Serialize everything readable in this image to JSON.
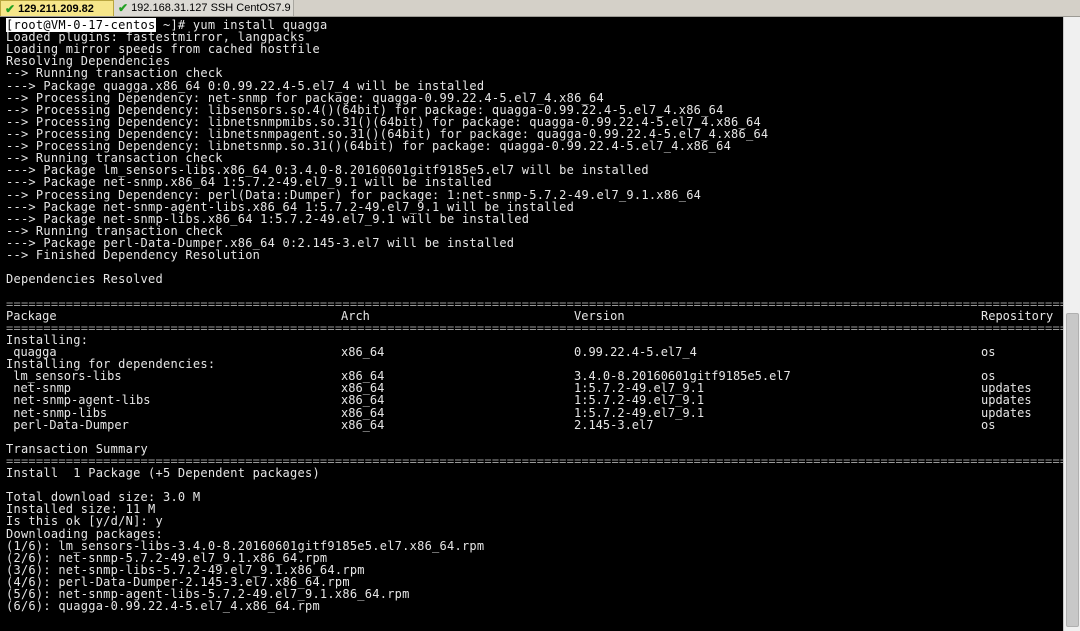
{
  "tabs": [
    {
      "label": "129.211.209.82",
      "active": true
    },
    {
      "label": "192.168.31.127 SSH CentOS7.9",
      "active": false
    }
  ],
  "prompt": {
    "user": "[root@VM-0-17-centos",
    "rest": " ~]# yum install quagga"
  },
  "pre_lines": [
    "Loaded plugins: fastestmirror, langpacks",
    "Loading mirror speeds from cached hostfile",
    "Resolving Dependencies",
    "--> Running transaction check",
    "---> Package quagga.x86_64 0:0.99.22.4-5.el7_4 will be installed",
    "--> Processing Dependency: net-snmp for package: quagga-0.99.22.4-5.el7_4.x86_64",
    "--> Processing Dependency: libsensors.so.4()(64bit) for package: quagga-0.99.22.4-5.el7_4.x86_64",
    "--> Processing Dependency: libnetsnmpmibs.so.31()(64bit) for package: quagga-0.99.22.4-5.el7_4.x86_64",
    "--> Processing Dependency: libnetsnmpagent.so.31()(64bit) for package: quagga-0.99.22.4-5.el7_4.x86_64",
    "--> Processing Dependency: libnetsnmp.so.31()(64bit) for package: quagga-0.99.22.4-5.el7_4.x86_64",
    "--> Running transaction check",
    "---> Package lm_sensors-libs.x86_64 0:3.4.0-8.20160601gitf9185e5.el7 will be installed",
    "---> Package net-snmp.x86_64 1:5.7.2-49.el7_9.1 will be installed",
    "--> Processing Dependency: perl(Data::Dumper) for package: 1:net-snmp-5.7.2-49.el7_9.1.x86_64",
    "---> Package net-snmp-agent-libs.x86_64 1:5.7.2-49.el7_9.1 will be installed",
    "---> Package net-snmp-libs.x86_64 1:5.7.2-49.el7_9.1 will be installed",
    "--> Running transaction check",
    "---> Package perl-Data-Dumper.x86_64 0:2.145-3.el7 will be installed",
    "--> Finished Dependency Resolution",
    "",
    "Dependencies Resolved",
    ""
  ],
  "table": {
    "headers": [
      "Package",
      "Arch",
      "Version",
      "Repository"
    ],
    "installing_label": "Installing:",
    "installing": [
      {
        "name": " quagga",
        "arch": "x86_64",
        "version": "0.99.22.4-5.el7_4",
        "repo": "os"
      }
    ],
    "deps_label": "Installing for dependencies:",
    "deps": [
      {
        "name": " lm_sensors-libs",
        "arch": "x86_64",
        "version": "3.4.0-8.20160601gitf9185e5.el7",
        "repo": "os"
      },
      {
        "name": " net-snmp",
        "arch": "x86_64",
        "version": "1:5.7.2-49.el7_9.1",
        "repo": "updates"
      },
      {
        "name": " net-snmp-agent-libs",
        "arch": "x86_64",
        "version": "1:5.7.2-49.el7_9.1",
        "repo": "updates"
      },
      {
        "name": " net-snmp-libs",
        "arch": "x86_64",
        "version": "1:5.7.2-49.el7_9.1",
        "repo": "updates"
      },
      {
        "name": " perl-Data-Dumper",
        "arch": "x86_64",
        "version": "2.145-3.el7",
        "repo": "os"
      }
    ]
  },
  "summary_title": "Transaction Summary",
  "summary_line": "Install  1 Package (+5 Dependent packages)",
  "post_lines": [
    "",
    "Total download size: 3.0 M",
    "Installed size: 11 M",
    "Is this ok [y/d/N]: y",
    "Downloading packages:",
    "(1/6): lm_sensors-libs-3.4.0-8.20160601gitf9185e5.el7.x86_64.rpm",
    "(2/6): net-snmp-5.7.2-49.el7_9.1.x86_64.rpm",
    "(3/6): net-snmp-libs-5.7.2-49.el7_9.1.x86_64.rpm",
    "(4/6): perl-Data-Dumper-2.145-3.el7.x86_64.rpm",
    "(5/6): net-snmp-agent-libs-5.7.2-49.el7_9.1.x86_64.rpm",
    "(6/6): quagga-0.99.22.4-5.el7_4.x86_64.rpm"
  ],
  "separator_char": "="
}
